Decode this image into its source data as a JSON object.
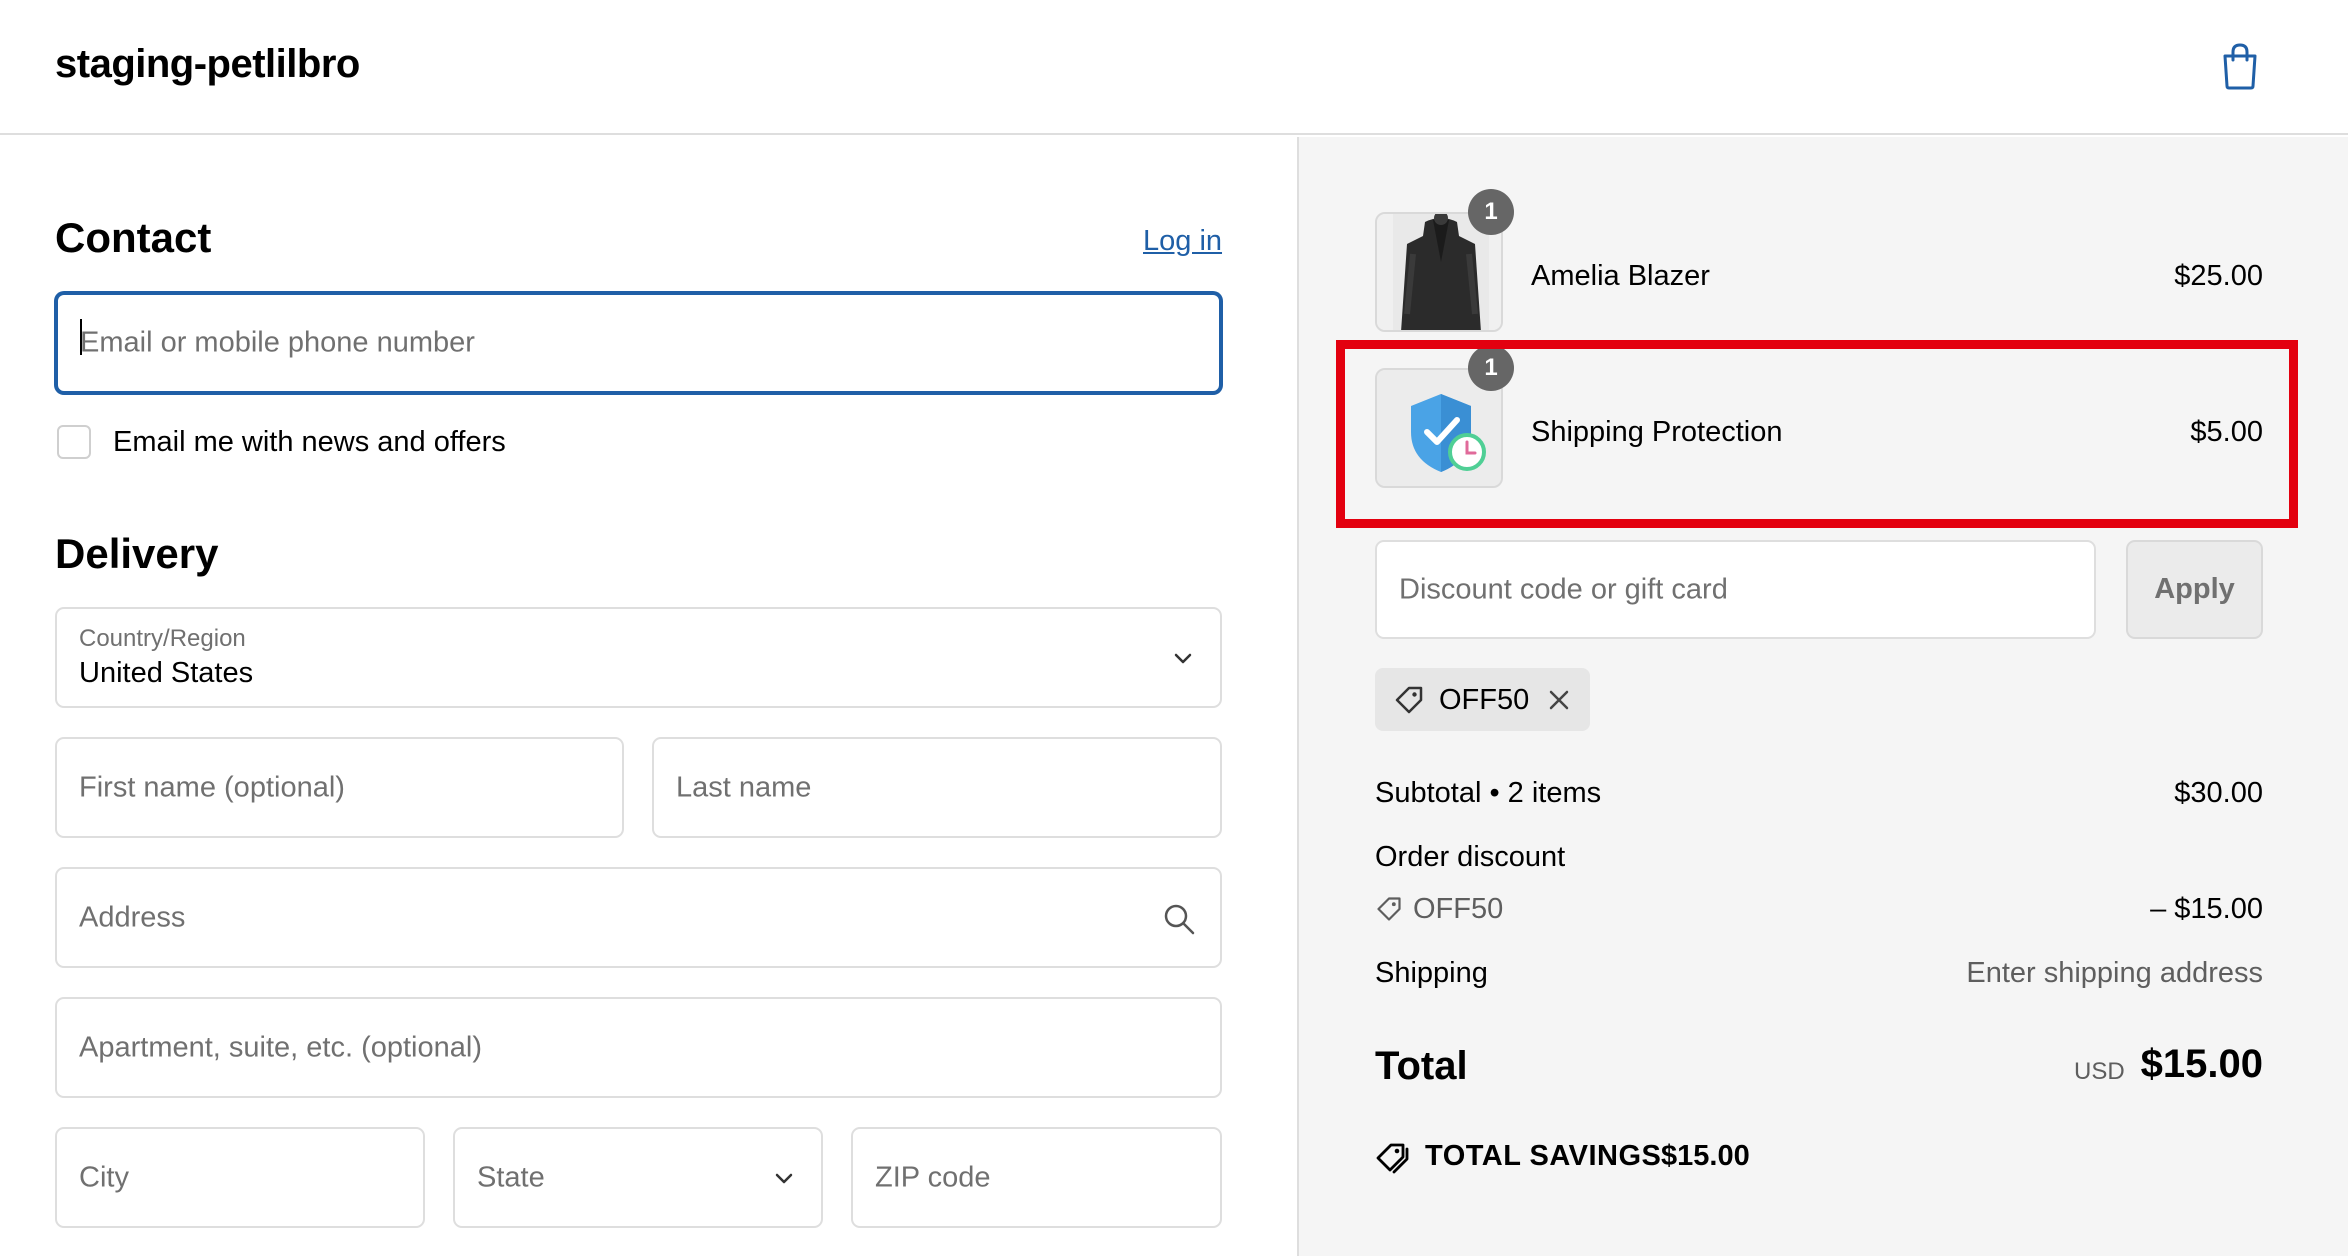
{
  "header": {
    "shop_name": "staging-petlilbro",
    "cart_icon": "shopping-bag-icon"
  },
  "contact": {
    "heading": "Contact",
    "login_link": "Log in",
    "email_placeholder": "Email or mobile phone number",
    "newsletter_label": "Email me with news and offers",
    "newsletter_checked": false
  },
  "delivery": {
    "heading": "Delivery",
    "country_label": "Country/Region",
    "country_value": "United States",
    "first_name_placeholder": "First name (optional)",
    "last_name_placeholder": "Last name",
    "address_placeholder": "Address",
    "apartment_placeholder": "Apartment, suite, etc. (optional)",
    "city_placeholder": "City",
    "state_placeholder": "State",
    "zip_placeholder": "ZIP code"
  },
  "order": {
    "items": [
      {
        "name": "Amelia Blazer",
        "price": "$25.00",
        "quantity": "1"
      },
      {
        "name": "Shipping Protection",
        "price": "$5.00",
        "quantity": "1"
      }
    ],
    "discount_placeholder": "Discount code or gift card",
    "apply_label": "Apply",
    "applied_code": "OFF50",
    "subtotal_label": "Subtotal • 2 items",
    "subtotal_value": "$30.00",
    "order_discount_label": "Order discount",
    "discount_code": "OFF50",
    "discount_value": "– $15.00",
    "shipping_label": "Shipping",
    "shipping_value": "Enter shipping address",
    "total_label": "Total",
    "total_currency": "USD",
    "total_value": "$15.00",
    "savings_label": "TOTAL SAVINGS",
    "savings_value": "$15.00"
  },
  "colors": {
    "link": "#1f5fa7",
    "highlight": "#e3000f",
    "summary_bg": "#f5f5f5"
  }
}
